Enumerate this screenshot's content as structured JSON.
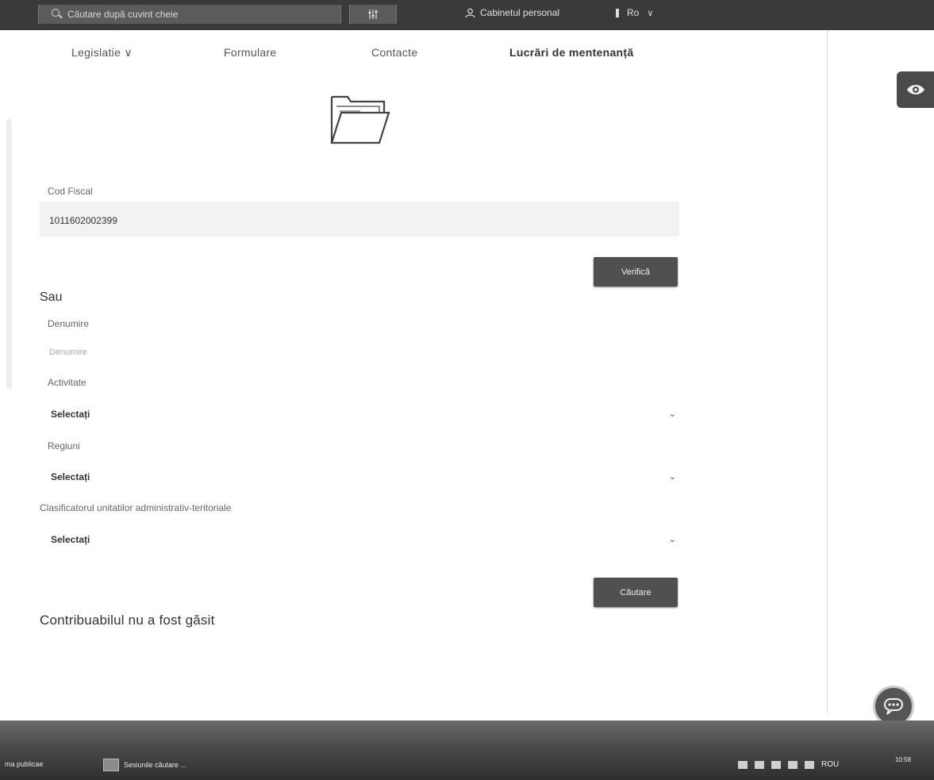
{
  "topbar": {
    "search_placeholder": "Căutare după cuvint cheie",
    "cabinet_label": "Cabinetul personal",
    "lang_label": "Ro"
  },
  "nav": {
    "items": [
      {
        "label": "Legislatie ∨"
      },
      {
        "label": "Formulare"
      },
      {
        "label": "Contacte"
      },
      {
        "label": "Lucrări de mentenanță"
      }
    ]
  },
  "form": {
    "cod_fiscal_label": "Cod Fiscal",
    "cod_fiscal_value": "1011602002399",
    "verifica_label": "Verifică",
    "sau_label": "Sau",
    "denumire_label": "Denumire",
    "denumire_placeholder": "Denumire",
    "activitate_label": "Activitate",
    "activitate_value": "Selectați",
    "regiuni_label": "Regiuni",
    "regiuni_value": "Selectați",
    "cuatm_label": "Clasificatorul unitatilor administrativ-teritoriale",
    "cuatm_value": "Selectați",
    "cautare_label": "Căutare",
    "result_text": "Contribuabilul nu a fost găsit"
  },
  "taskbar": {
    "left_text": "ma publicae",
    "app_label": "Sesiunile căutare ...",
    "lang": "ROU",
    "time": "10:58"
  },
  "icons": {
    "search": "search-icon",
    "filter": "filter-icon",
    "user": "user-icon",
    "eye": "eye-icon",
    "folder": "folder-icon",
    "chat": "chat-icon"
  }
}
